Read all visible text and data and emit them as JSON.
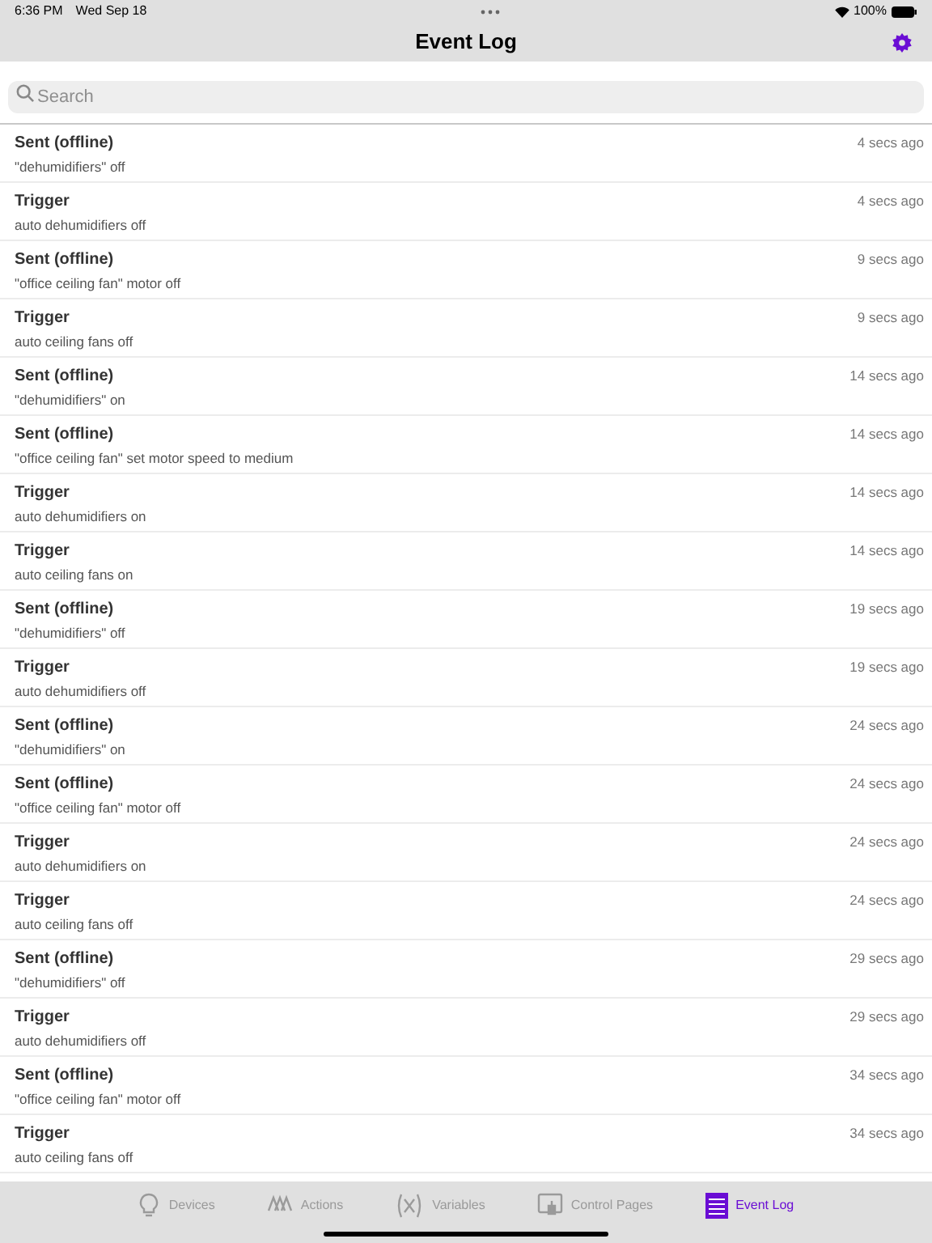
{
  "status_bar": {
    "time": "6:36 PM",
    "date": "Wed Sep 18",
    "battery": "100%"
  },
  "nav": {
    "title": "Event Log"
  },
  "search": {
    "placeholder": "Search"
  },
  "events": [
    {
      "title": "Sent (offline)",
      "detail": "\"dehumidifiers\" off",
      "time": "4 secs ago"
    },
    {
      "title": "Trigger",
      "detail": "auto dehumidifiers off",
      "time": "4 secs ago"
    },
    {
      "title": "Sent (offline)",
      "detail": "\"office ceiling fan\" motor off",
      "time": "9 secs ago"
    },
    {
      "title": "Trigger",
      "detail": "auto ceiling fans off",
      "time": "9 secs ago"
    },
    {
      "title": "Sent (offline)",
      "detail": "\"dehumidifiers\" on",
      "time": "14 secs ago"
    },
    {
      "title": "Sent (offline)",
      "detail": "\"office ceiling fan\" set motor speed to medium",
      "time": "14 secs ago"
    },
    {
      "title": "Trigger",
      "detail": "auto dehumidifiers on",
      "time": "14 secs ago"
    },
    {
      "title": "Trigger",
      "detail": "auto ceiling fans on",
      "time": "14 secs ago"
    },
    {
      "title": "Sent (offline)",
      "detail": "\"dehumidifiers\" off",
      "time": "19 secs ago"
    },
    {
      "title": "Trigger",
      "detail": "auto dehumidifiers off",
      "time": "19 secs ago"
    },
    {
      "title": "Sent (offline)",
      "detail": "\"dehumidifiers\" on",
      "time": "24 secs ago"
    },
    {
      "title": "Sent (offline)",
      "detail": "\"office ceiling fan\" motor off",
      "time": "24 secs ago"
    },
    {
      "title": "Trigger",
      "detail": "auto dehumidifiers on",
      "time": "24 secs ago"
    },
    {
      "title": "Trigger",
      "detail": "auto ceiling fans off",
      "time": "24 secs ago"
    },
    {
      "title": "Sent (offline)",
      "detail": "\"dehumidifiers\" off",
      "time": "29 secs ago"
    },
    {
      "title": "Trigger",
      "detail": "auto dehumidifiers off",
      "time": "29 secs ago"
    },
    {
      "title": "Sent (offline)",
      "detail": "\"office ceiling fan\" motor off",
      "time": "34 secs ago"
    },
    {
      "title": "Trigger",
      "detail": "auto ceiling fans off",
      "time": "34 secs ago"
    }
  ],
  "tabs": [
    {
      "kind": "devices",
      "label": "Devices",
      "selected": false
    },
    {
      "kind": "actions",
      "label": "Actions",
      "selected": false
    },
    {
      "kind": "variables",
      "label": "Variables",
      "selected": false
    },
    {
      "kind": "pages",
      "label": "Control Pages",
      "selected": false
    },
    {
      "kind": "log",
      "label": "Event Log",
      "selected": true
    }
  ]
}
